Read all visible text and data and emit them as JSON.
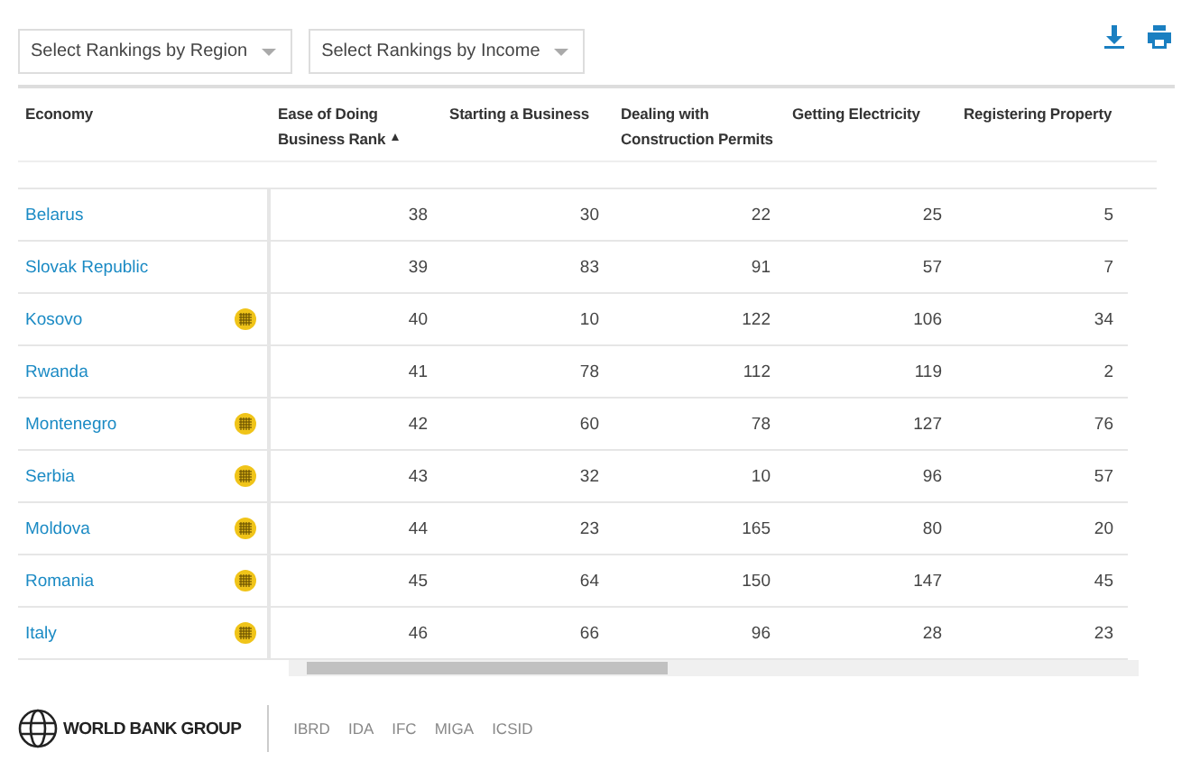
{
  "filters": [
    {
      "label": "Select Rankings by Region"
    },
    {
      "label": "Select Rankings by Income"
    }
  ],
  "table": {
    "columns": [
      {
        "label": "Economy",
        "sorted": false
      },
      {
        "label": "Ease of Doing Business Rank",
        "sorted": true
      },
      {
        "label": "Starting a Business",
        "sorted": false
      },
      {
        "label": "Dealing with Construction Permits",
        "sorted": false
      },
      {
        "label": "Getting Electricity",
        "sorted": false
      },
      {
        "label": "Registering Property",
        "sorted": false
      }
    ],
    "rows": [
      {
        "economy": "Belarus",
        "badge": false,
        "values": [
          "38",
          "30",
          "22",
          "25",
          "5"
        ]
      },
      {
        "economy": "Slovak Republic",
        "badge": false,
        "values": [
          "39",
          "83",
          "91",
          "57",
          "7"
        ]
      },
      {
        "economy": "Kosovo",
        "badge": true,
        "values": [
          "40",
          "10",
          "122",
          "106",
          "34"
        ]
      },
      {
        "economy": "Rwanda",
        "badge": false,
        "values": [
          "41",
          "78",
          "112",
          "119",
          "2"
        ]
      },
      {
        "economy": "Montenegro",
        "badge": true,
        "values": [
          "42",
          "60",
          "78",
          "127",
          "76"
        ]
      },
      {
        "economy": "Serbia",
        "badge": true,
        "values": [
          "43",
          "32",
          "10",
          "96",
          "57"
        ]
      },
      {
        "economy": "Moldova",
        "badge": true,
        "values": [
          "44",
          "23",
          "165",
          "80",
          "20"
        ]
      },
      {
        "economy": "Romania",
        "badge": true,
        "values": [
          "45",
          "64",
          "150",
          "147",
          "45"
        ]
      },
      {
        "economy": "Italy",
        "badge": true,
        "values": [
          "46",
          "66",
          "96",
          "28",
          "23"
        ]
      }
    ]
  },
  "footer": {
    "brand": "WORLD BANK GROUP",
    "links": [
      "IBRD",
      "IDA",
      "IFC",
      "MIGA",
      "ICSID"
    ]
  }
}
